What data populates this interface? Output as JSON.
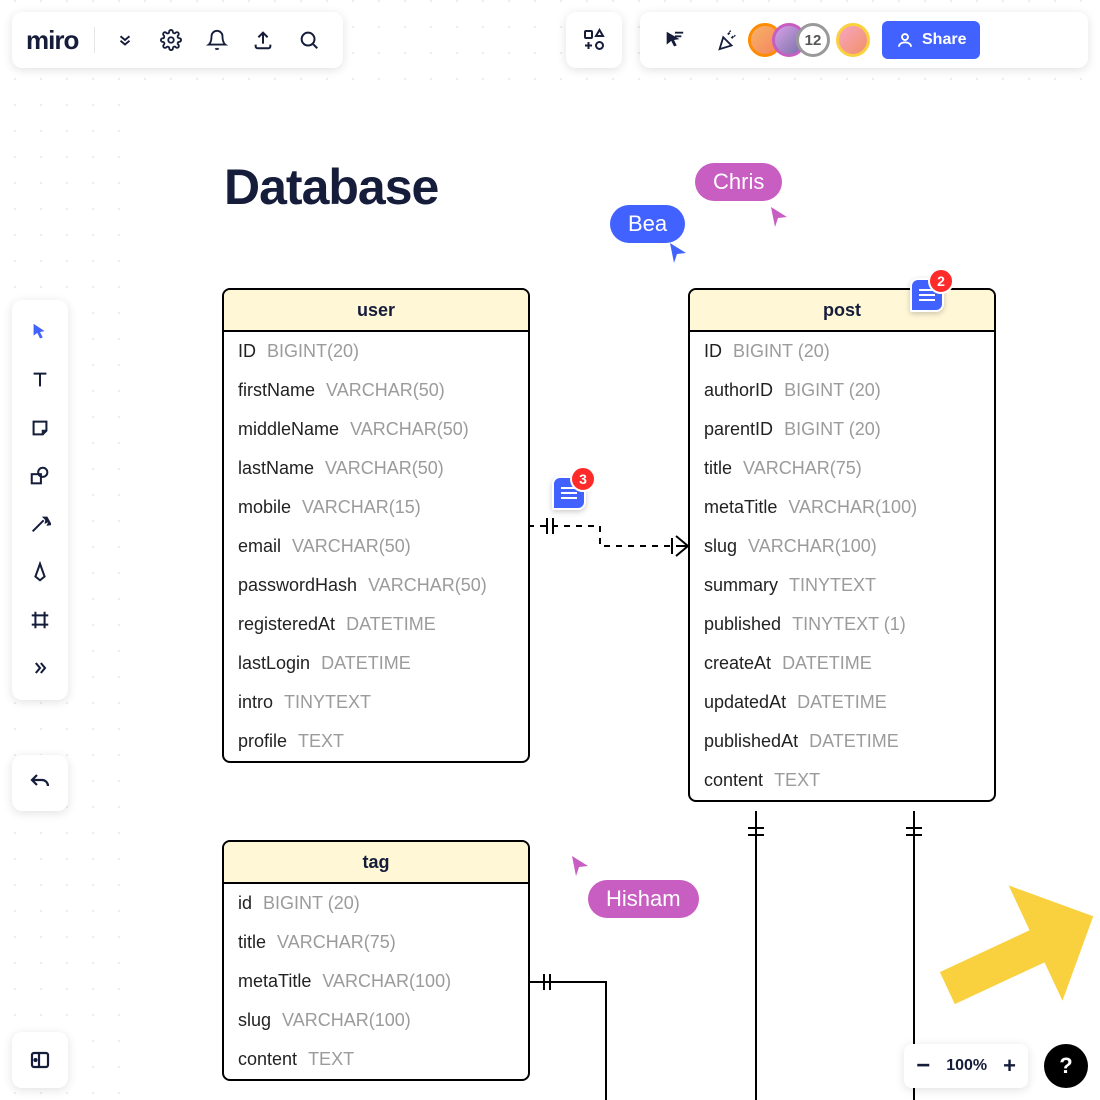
{
  "logo": "miro",
  "share_label": "Share",
  "avatar_count": "12",
  "zoom_level": "100%",
  "page_title": "Database",
  "collaborators": {
    "bea": "Bea",
    "chris": "Chris",
    "hisham": "Hisham"
  },
  "comments": {
    "left": "3",
    "right": "2"
  },
  "entities": {
    "user": {
      "name": "user",
      "cols": [
        {
          "n": "ID",
          "t": "BIGINT(20)"
        },
        {
          "n": "firstName",
          "t": "VARCHAR(50)"
        },
        {
          "n": "middleName",
          "t": "VARCHAR(50)"
        },
        {
          "n": "lastName",
          "t": "VARCHAR(50)"
        },
        {
          "n": "mobile",
          "t": "VARCHAR(15)"
        },
        {
          "n": "email",
          "t": "VARCHAR(50)"
        },
        {
          "n": "passwordHash",
          "t": "VARCHAR(50)"
        },
        {
          "n": "registeredAt",
          "t": "DATETIME"
        },
        {
          "n": "lastLogin",
          "t": "DATETIME"
        },
        {
          "n": "intro",
          "t": "TINYTEXT"
        },
        {
          "n": "profile",
          "t": "TEXT"
        }
      ]
    },
    "post": {
      "name": "post",
      "cols": [
        {
          "n": "ID",
          "t": "BIGINT (20)"
        },
        {
          "n": "authorID",
          "t": "BIGINT (20)"
        },
        {
          "n": "parentID",
          "t": "BIGINT (20)"
        },
        {
          "n": "title",
          "t": "VARCHAR(75)"
        },
        {
          "n": "metaTitle",
          "t": "VARCHAR(100)"
        },
        {
          "n": "slug",
          "t": "VARCHAR(100)"
        },
        {
          "n": "summary",
          "t": "TINYTEXT"
        },
        {
          "n": "published",
          "t": "TINYTEXT (1)"
        },
        {
          "n": "createAt",
          "t": "DATETIME"
        },
        {
          "n": "updatedAt",
          "t": "DATETIME"
        },
        {
          "n": "publishedAt",
          "t": "DATETIME"
        },
        {
          "n": "content",
          "t": "TEXT"
        }
      ]
    },
    "tag": {
      "name": "tag",
      "cols": [
        {
          "n": "id",
          "t": "BIGINT (20)"
        },
        {
          "n": "title",
          "t": "VARCHAR(75)"
        },
        {
          "n": "metaTitle",
          "t": "VARCHAR(100)"
        },
        {
          "n": "slug",
          "t": "VARCHAR(100)"
        },
        {
          "n": "content",
          "t": "TEXT"
        }
      ]
    }
  }
}
